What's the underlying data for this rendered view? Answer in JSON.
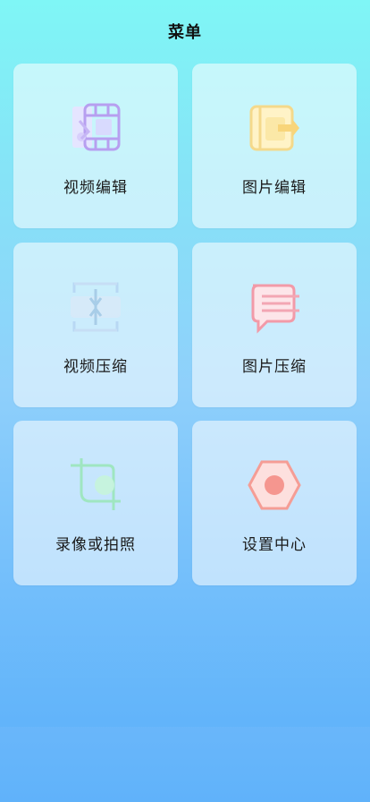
{
  "header": {
    "title": "菜单"
  },
  "menu": {
    "items": [
      {
        "label": "视频编辑",
        "icon": "video-edit-icon",
        "color": "#b9a2f2"
      },
      {
        "label": "图片编辑",
        "icon": "image-edit-icon",
        "color": "#f6d88a"
      },
      {
        "label": "视频压缩",
        "icon": "video-compress-icon",
        "color": "#b7d7f3"
      },
      {
        "label": "图片压缩",
        "icon": "image-compress-icon",
        "color": "#f29aa8"
      },
      {
        "label": "录像或拍照",
        "icon": "crop-camera-icon",
        "color": "#a6eec8"
      },
      {
        "label": "设置中心",
        "icon": "settings-hexagon-icon",
        "color": "#f69a93"
      }
    ]
  }
}
